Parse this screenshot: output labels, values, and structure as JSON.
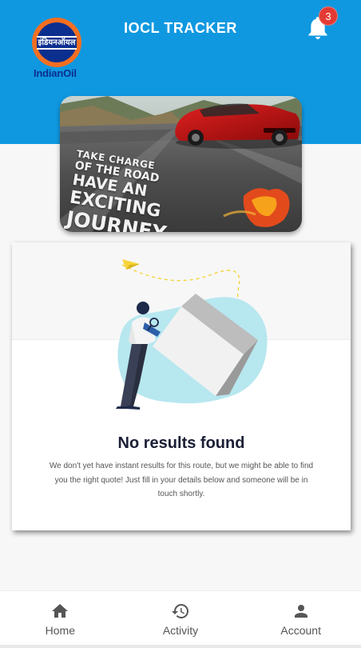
{
  "header": {
    "title": "IOCL TRACKER",
    "logo_text": "IndianOil",
    "logo_hindi": "इंडियनऑयल",
    "notification_count": "3",
    "color": "#0f98e0"
  },
  "banner": {
    "line1": "TAKE CHARGE",
    "line2": "OF THE ROAD",
    "line3": "HAVE AN",
    "line4": "EXCITING",
    "line5": "JOURNEY"
  },
  "empty_state": {
    "title": "No results found",
    "message": "We don't yet have instant results for this route, but we might be able to find you the right quote! Just fill in your details below and someone will be in touch shortly."
  },
  "bottom_nav": {
    "items": [
      {
        "label": "Home",
        "icon": "home-icon"
      },
      {
        "label": "Activity",
        "icon": "history-icon"
      },
      {
        "label": "Account",
        "icon": "account-icon"
      }
    ]
  }
}
